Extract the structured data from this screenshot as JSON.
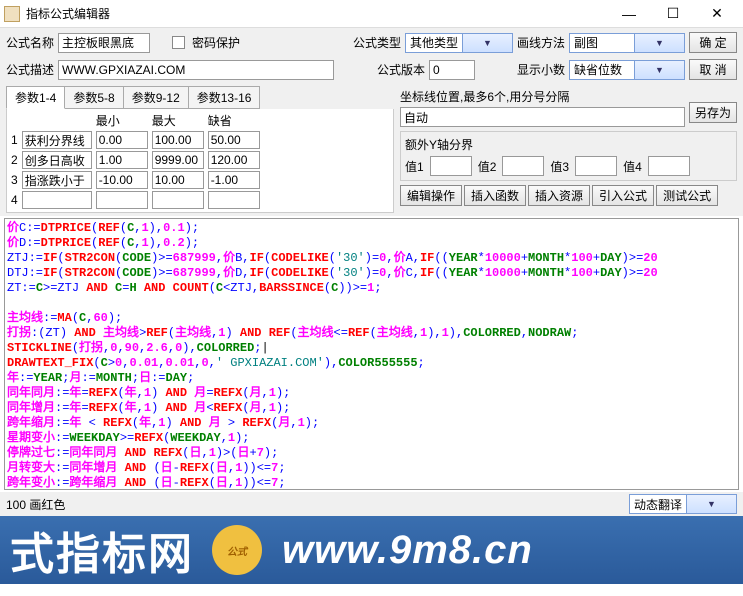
{
  "window": {
    "title": "指标公式编辑器"
  },
  "row1": {
    "name_lbl": "公式名称",
    "name_val": "主控板眼黑底",
    "pwd_lbl": "密码保护",
    "type_lbl": "公式类型",
    "type_val": "其他类型",
    "draw_lbl": "画线方法",
    "draw_val": "副图",
    "ok": "确  定"
  },
  "row2": {
    "desc_lbl": "公式描述",
    "desc_val": "WWW.GPXIAZAI.COM",
    "ver_lbl": "公式版本",
    "ver_val": "0",
    "dec_lbl": "显示小数",
    "dec_val": "缺省位数",
    "cancel": "取  消"
  },
  "tabs": [
    "参数1-4",
    "参数5-8",
    "参数9-12",
    "参数13-16"
  ],
  "phead": {
    "min": "最小",
    "max": "最大",
    "def": "缺省"
  },
  "params": [
    {
      "n": "1",
      "name": "获利分界线",
      "min": "0.00",
      "max": "100.00",
      "def": "50.00"
    },
    {
      "n": "2",
      "name": "创多日高收",
      "min": "1.00",
      "max": "9999.00",
      "def": "120.00"
    },
    {
      "n": "3",
      "name": "指涨跌小于",
      "min": "-10.00",
      "max": "10.00",
      "def": "-1.00"
    },
    {
      "n": "4",
      "name": "",
      "min": "",
      "max": "",
      "def": ""
    }
  ],
  "right": {
    "coord_lbl": "坐标线位置,最多6个,用分号分隔",
    "coord_val": "自动",
    "yaxis_lbl": "额外Y轴分界",
    "v1": "值1",
    "v2": "值2",
    "v3": "值3",
    "v4": "值4",
    "saveas": "另存为"
  },
  "btns": {
    "edit": "编辑操作",
    "insfn": "插入函数",
    "insres": "插入资源",
    "import": "引入公式",
    "test": "测试公式"
  },
  "footer": {
    "left": "100 画红色",
    "right": "动态翻译"
  },
  "banner": {
    "cn": "式指标网",
    "url": "www.9m8.cn"
  }
}
